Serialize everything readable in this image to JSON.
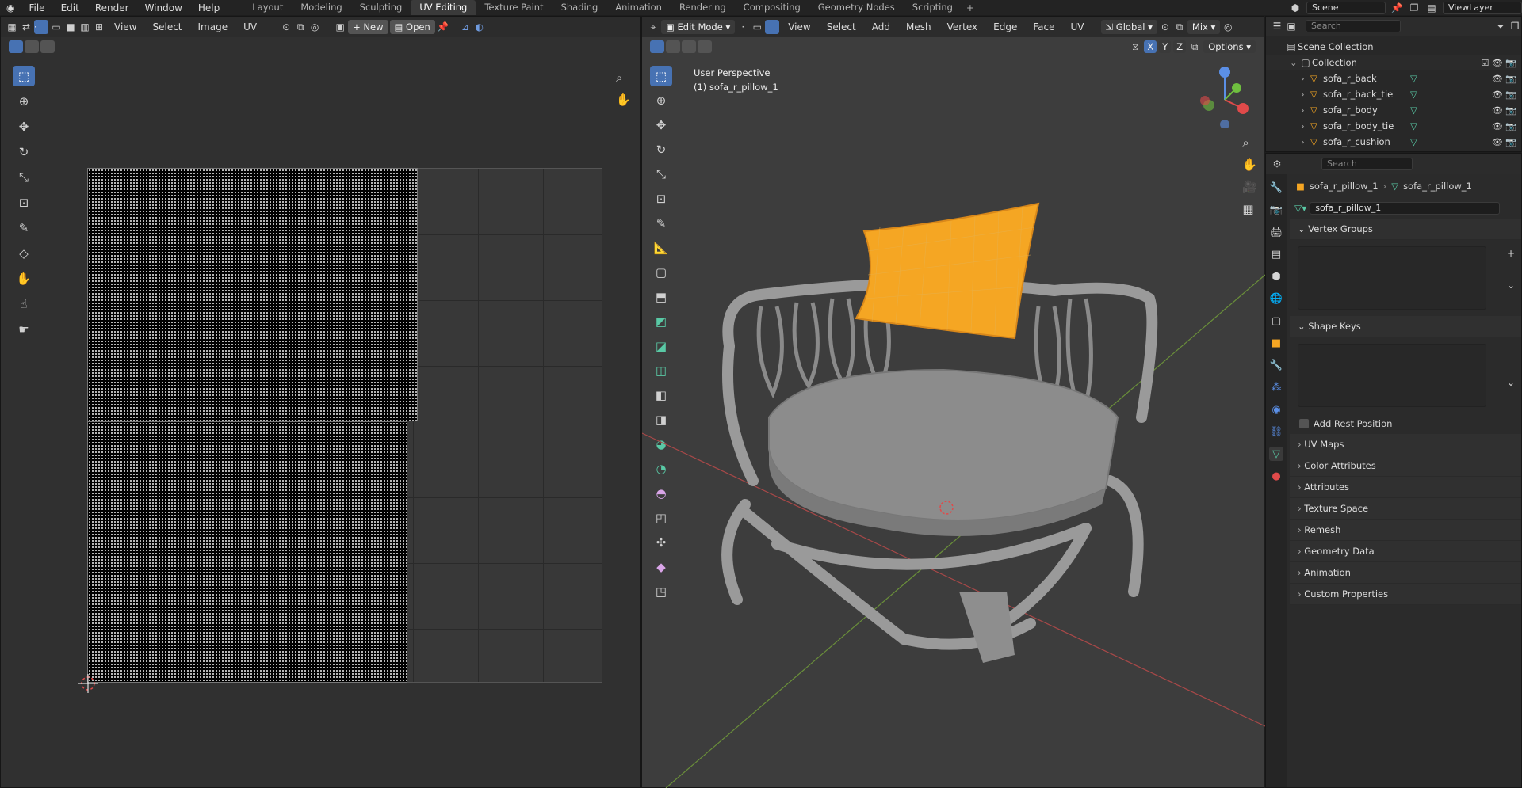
{
  "menu": [
    "File",
    "Edit",
    "Render",
    "Window",
    "Help"
  ],
  "workspaces": [
    "Layout",
    "Modeling",
    "Sculpting",
    "UV Editing",
    "Texture Paint",
    "Shading",
    "Animation",
    "Rendering",
    "Compositing",
    "Geometry Nodes",
    "Scripting"
  ],
  "active_workspace": "UV Editing",
  "scene": "Scene",
  "view_layer": "ViewLayer",
  "uv_header": {
    "menus": [
      "View",
      "Select",
      "Image",
      "UV"
    ],
    "new_label": "New",
    "open_label": "Open"
  },
  "viewport_header": {
    "mode": "Edit Mode",
    "menus": [
      "View",
      "Select",
      "Add",
      "Mesh",
      "Vertex",
      "Edge",
      "Face",
      "UV"
    ],
    "orientation": "Global",
    "shading": "Mix",
    "options": "Options",
    "axes": [
      "X",
      "Y",
      "Z"
    ]
  },
  "viewport": {
    "perspective": "User Perspective",
    "object": "(1) sofa_r_pillow_1"
  },
  "outliner": {
    "search_placeholder": "Search",
    "scene_collection": "Scene Collection",
    "collection": "Collection",
    "objects": [
      "sofa_r_back",
      "sofa_r_back_tie",
      "sofa_r_body",
      "sofa_r_body_tie",
      "sofa_r_cushion"
    ]
  },
  "properties": {
    "search_placeholder": "Search",
    "breadcrumb_object": "sofa_r_pillow_1",
    "breadcrumb_mesh": "sofa_r_pillow_1",
    "mesh_name": "sofa_r_pillow_1",
    "vertex_groups": "Vertex Groups",
    "shape_keys": "Shape Keys",
    "add_rest_position": "Add Rest Position",
    "panels": [
      "UV Maps",
      "Color Attributes",
      "Attributes",
      "Texture Space",
      "Remesh",
      "Geometry Data",
      "Animation",
      "Custom Properties"
    ]
  },
  "colors": {
    "accent": "#4772b3",
    "selection": "#f5a623",
    "mesh_icon": "#59c9a5"
  }
}
